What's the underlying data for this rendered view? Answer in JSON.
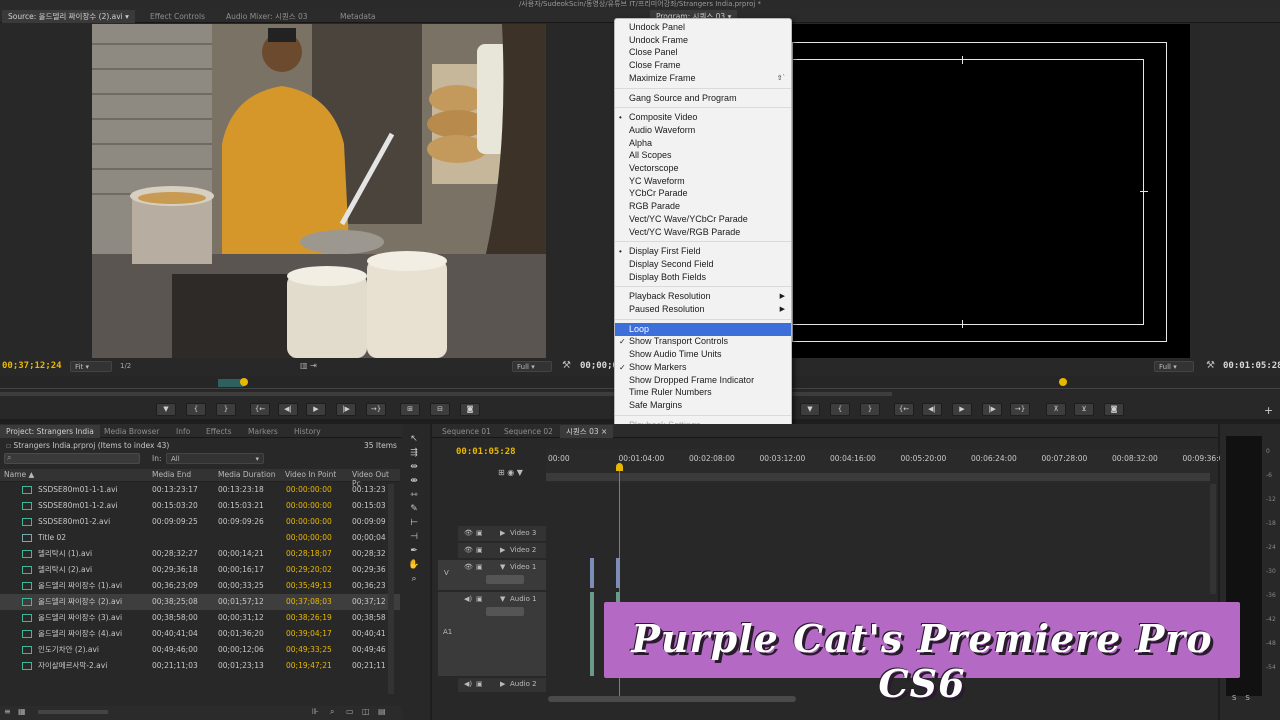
{
  "window_title": "/사용자/SudeokScin/동영상/유튜브 IT/프리미어강좌/Strangers India.prproj *",
  "source_tabs": [
    {
      "label": "Source: 올드델리 짜이장수 (2).avi ▾",
      "active": true
    },
    {
      "label": "Effect Controls",
      "active": false
    },
    {
      "label": "Audio Mixer: 시퀀스 03",
      "active": false
    },
    {
      "label": "Metadata",
      "active": false
    }
  ],
  "program_tab": "Program: 시퀀스 03 ▾",
  "source": {
    "timecode": "00;37;12;24",
    "fit": "Fit",
    "fraction": "1/2",
    "quality": "Full",
    "duration_partial": "00;00;0"
  },
  "program": {
    "timecode": "00:01:05:28",
    "quality": "Full"
  },
  "menu": {
    "items": [
      {
        "label": "Undock Panel"
      },
      {
        "label": "Undock Frame"
      },
      {
        "label": "Close Panel"
      },
      {
        "label": "Close Frame"
      },
      {
        "label": "Maximize Frame",
        "shortcut": "⇧`"
      },
      {
        "sep": true
      },
      {
        "label": "Gang Source and Program"
      },
      {
        "sep": true
      },
      {
        "label": "Composite Video",
        "mark": "•"
      },
      {
        "label": "Audio Waveform"
      },
      {
        "label": "Alpha"
      },
      {
        "label": "All Scopes"
      },
      {
        "label": "Vectorscope"
      },
      {
        "label": "YC Waveform"
      },
      {
        "label": "YCbCr Parade"
      },
      {
        "label": "RGB Parade"
      },
      {
        "label": "Vect/YC Wave/YCbCr Parade"
      },
      {
        "label": "Vect/YC Wave/RGB Parade"
      },
      {
        "sep": true
      },
      {
        "label": "Display First Field",
        "mark": "•"
      },
      {
        "label": "Display Second Field"
      },
      {
        "label": "Display Both Fields"
      },
      {
        "sep": true
      },
      {
        "label": "Playback Resolution",
        "submenu": "▶"
      },
      {
        "label": "Paused Resolution",
        "submenu": "▶"
      },
      {
        "sep": true
      },
      {
        "label": "Loop",
        "selected": true
      },
      {
        "label": "Show Transport Controls",
        "mark": "✓"
      },
      {
        "label": "Show Audio Time Units"
      },
      {
        "label": "Show Markers",
        "mark": "✓"
      },
      {
        "label": "Show Dropped Frame Indicator"
      },
      {
        "label": "Time Ruler Numbers"
      },
      {
        "label": "Safe Margins"
      },
      {
        "sep": true
      },
      {
        "label": "Playback Settings...",
        "disabled": true
      }
    ]
  },
  "project": {
    "tabs": [
      "Project: Strangers India",
      "Media Browser",
      "Info",
      "Effects",
      "Markers",
      "History"
    ],
    "file": "Strangers India.prproj (Items to index 43)",
    "count": "35 Items",
    "in_label": "In:",
    "in_value": "All",
    "columns": [
      "Name",
      "Media End",
      "Media Duration",
      "Video In Point",
      "Video Out Pc"
    ],
    "rows": [
      {
        "name": "SSDSE80m01-1-1.avi",
        "end": "00:13:23:17",
        "dur": "00:13:23:18",
        "in": "00:00:00:00",
        "out": "00:13:23",
        "icon": "clip"
      },
      {
        "name": "SSDSE80m01-1-2.avi",
        "end": "00:15:03:20",
        "dur": "00:15:03:21",
        "in": "00:00:00:00",
        "out": "00:15:03",
        "icon": "clip"
      },
      {
        "name": "SSDSE80m01-2.avi",
        "end": "00:09:09:25",
        "dur": "00:09:09:26",
        "in": "00:00:00:00",
        "out": "00:09:09",
        "icon": "clip"
      },
      {
        "name": "Title 02",
        "end": "",
        "dur": "",
        "in": "00;00;00;00",
        "out": "00;00;04",
        "icon": "title"
      },
      {
        "name": "델리탁시 (1).avi",
        "end": "00;28;32;27",
        "dur": "00;00;14;21",
        "in": "00;28;18;07",
        "out": "00;28;32",
        "icon": "clip"
      },
      {
        "name": "델리탁시 (2).avi",
        "end": "00;29;36;18",
        "dur": "00;00;16;17",
        "in": "00;29;20;02",
        "out": "00;29;36",
        "icon": "clip"
      },
      {
        "name": "올드델리 짜이장수 (1).avi",
        "end": "00;36;23;09",
        "dur": "00;00;33;25",
        "in": "00;35;49;13",
        "out": "00;36;23",
        "icon": "clip"
      },
      {
        "name": "올드델리 짜이장수 (2).avi",
        "end": "00;38;25;08",
        "dur": "00;01;57;12",
        "in": "00;37;08;03",
        "out": "00;37;12",
        "icon": "clip",
        "highlight": true
      },
      {
        "name": "올드델리 짜이장수 (3).avi",
        "end": "00;38;58;00",
        "dur": "00;00;31;12",
        "in": "00;38;26;19",
        "out": "00;38;58",
        "icon": "clip"
      },
      {
        "name": "올드델리 짜이장수 (4).avi",
        "end": "00;40;41;04",
        "dur": "00;01;36;20",
        "in": "00;39;04;17",
        "out": "00;40;41",
        "icon": "clip"
      },
      {
        "name": "인도기차안 (2).avi",
        "end": "00;49;46;00",
        "dur": "00;00;12;06",
        "in": "00;49;33;25",
        "out": "00;49;46",
        "icon": "clip"
      },
      {
        "name": "자이살메르사막-2.avi",
        "end": "00;21;11;03",
        "dur": "00;01;23;13",
        "in": "00;19;47;21",
        "out": "00;21;11",
        "icon": "clip"
      }
    ]
  },
  "timeline": {
    "tabs": [
      {
        "label": "Sequence 01",
        "active": false
      },
      {
        "label": "Sequence 02",
        "active": false
      },
      {
        "label": "시퀀스 03 ×",
        "active": true
      }
    ],
    "timecode": "00:01:05:28",
    "ruler": [
      "00:00",
      "00:01:04:00",
      "00:02:08:00",
      "00:03:12:00",
      "00:04:16:00",
      "00:05:20:00",
      "00:06:24:00",
      "00:07:28:00",
      "00:08:32:00",
      "00:09:36:00"
    ],
    "tracks": {
      "v3": "Video 3",
      "v2": "Video 2",
      "v1": "Video 1",
      "a1": "Audio 1",
      "a2": "Audio 2",
      "v_target": "V",
      "a_target": "A1"
    }
  },
  "meter": {
    "labels": [
      "0",
      "-6",
      "-12",
      "-18",
      "-24",
      "-30",
      "-36",
      "-42",
      "-48",
      "-54"
    ],
    "solo": [
      "S",
      "S"
    ]
  },
  "watermark": "Purple Cat's Premiere Pro CS6",
  "colors": {
    "timecode": "#e8b800",
    "menu_selection": "#3d6fdb",
    "watermark_bg": "#b46ac4",
    "playhead": "#e25a2a"
  }
}
